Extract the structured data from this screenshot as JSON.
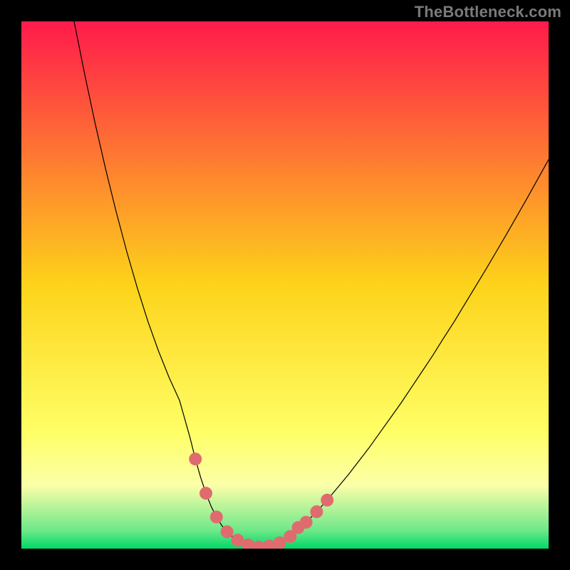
{
  "watermark": "TheBottleneck.com",
  "chart_data": {
    "type": "line",
    "title": "",
    "xlabel": "",
    "ylabel": "",
    "xlim": [
      0,
      100
    ],
    "ylim": [
      0,
      100
    ],
    "grid": false,
    "legend": false,
    "background_gradient": {
      "type": "vertical",
      "stops": [
        {
          "offset": 0.0,
          "color": "#ff1a4b"
        },
        {
          "offset": 0.5,
          "color": "#fdd31a"
        },
        {
          "offset": 0.78,
          "color": "#ffff66"
        },
        {
          "offset": 0.88,
          "color": "#fbffa8"
        },
        {
          "offset": 0.965,
          "color": "#6fe889"
        },
        {
          "offset": 1.0,
          "color": "#00d968"
        }
      ]
    },
    "series": [
      {
        "name": "bottleneck-curve",
        "color": "#000000",
        "stroke_width": 1.2,
        "x": [
          10,
          12,
          14,
          16,
          18,
          20,
          22,
          24,
          26,
          28,
          30,
          32,
          33,
          34,
          35,
          36,
          37,
          38,
          39,
          40,
          41,
          42,
          43,
          44,
          45,
          46,
          48,
          50,
          52,
          54,
          56,
          58,
          60,
          62,
          64,
          66,
          68,
          70,
          72,
          74,
          76,
          78,
          80,
          82,
          84,
          86,
          88,
          90,
          92,
          94,
          96,
          98,
          100
        ],
        "y": [
          100,
          90.0,
          80.6,
          71.9,
          63.8,
          56.3,
          49.4,
          43.1,
          37.5,
          32.5,
          28.1,
          21.0,
          17.0,
          13.5,
          10.5,
          8.0,
          6.0,
          4.4,
          3.2,
          2.3,
          1.6,
          1.1,
          0.7,
          0.5,
          0.3,
          0.3,
          0.7,
          1.6,
          3.2,
          5.0,
          7.0,
          9.2,
          11.6,
          14.0,
          16.6,
          19.2,
          22.0,
          24.8,
          27.6,
          30.6,
          33.6,
          36.6,
          39.8,
          42.9,
          46.2,
          49.5,
          52.8,
          56.2,
          59.6,
          63.1,
          66.6,
          70.2,
          73.8
        ]
      }
    ],
    "markers": {
      "name": "highlight-dots",
      "color": "#e06b6f",
      "radius": 9,
      "points": [
        {
          "x": 33.0,
          "y": 17.0
        },
        {
          "x": 35.0,
          "y": 10.5
        },
        {
          "x": 37.0,
          "y": 6.0
        },
        {
          "x": 39.0,
          "y": 3.2
        },
        {
          "x": 41.0,
          "y": 1.6
        },
        {
          "x": 43.0,
          "y": 0.7
        },
        {
          "x": 45.0,
          "y": 0.3
        },
        {
          "x": 47.0,
          "y": 0.5
        },
        {
          "x": 49.0,
          "y": 1.1
        },
        {
          "x": 51.0,
          "y": 2.3
        },
        {
          "x": 52.5,
          "y": 4.0
        },
        {
          "x": 54.0,
          "y": 5.0
        },
        {
          "x": 56.0,
          "y": 7.0
        },
        {
          "x": 58.0,
          "y": 9.2
        }
      ]
    }
  }
}
